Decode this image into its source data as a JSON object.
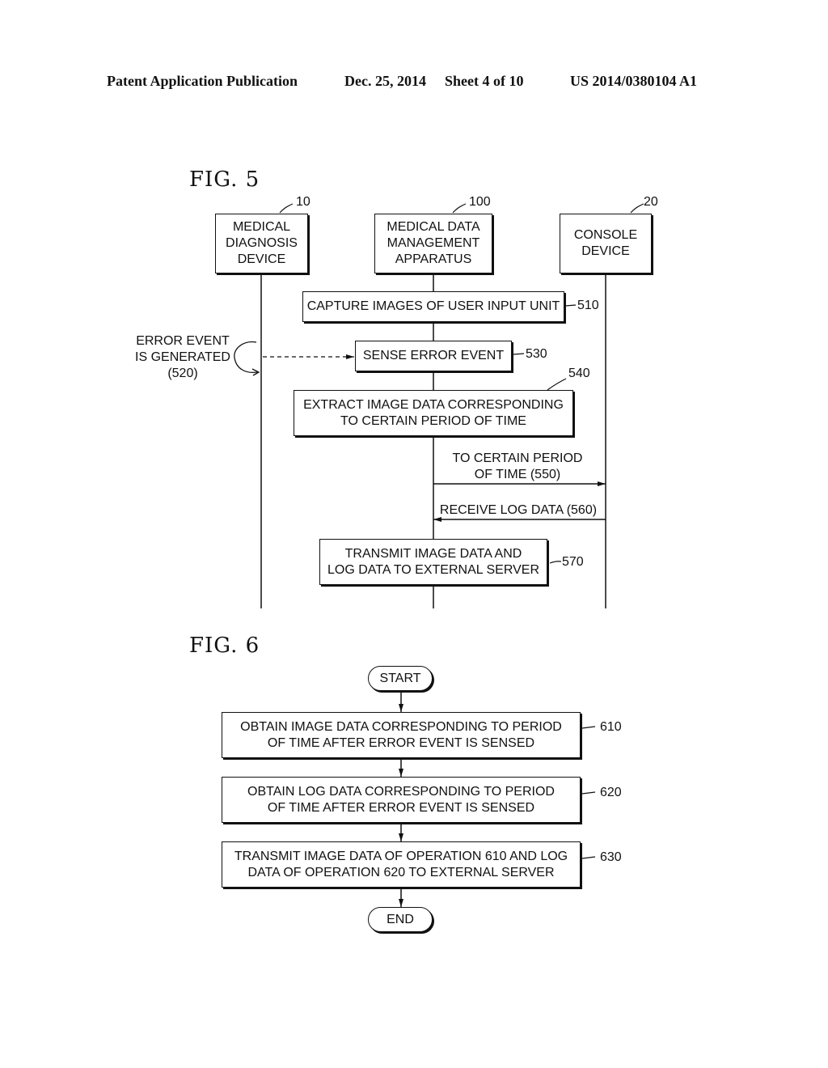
{
  "header": {
    "publication": "Patent Application Publication",
    "date": "Dec. 25, 2014",
    "sheet": "Sheet 4 of 10",
    "number": "US 2014/0380104 A1"
  },
  "fig5": {
    "title": "FIG.  5",
    "entities": [
      {
        "ref": "10",
        "label": "MEDICAL\nDIAGNOSIS\nDEVICE"
      },
      {
        "ref": "100",
        "label": "MEDICAL DATA\nMANAGEMENT\nAPPARATUS"
      },
      {
        "ref": "20",
        "label": "CONSOLE\nDEVICE"
      }
    ],
    "steps": [
      {
        "ref": "510",
        "label": "CAPTURE IMAGES OF USER INPUT UNIT"
      },
      {
        "ref": "530",
        "label": "SENSE ERROR EVENT"
      },
      {
        "ref": "540",
        "label": "EXTRACT IMAGE DATA CORRESPONDING\nTO CERTAIN PERIOD OF TIME"
      },
      {
        "ref": "570",
        "label": "TRANSMIT IMAGE DATA AND\nLOG DATA TO EXTERNAL SERVER"
      }
    ],
    "event_label": "ERROR EVENT\nIS GENERATED\n(520)",
    "messages": [
      {
        "label": "TO CERTAIN PERIOD\nOF TIME (550)"
      },
      {
        "label": "RECEIVE LOG DATA (560)"
      }
    ]
  },
  "fig6": {
    "title": "FIG.  6",
    "start": "START",
    "end": "END",
    "steps": [
      {
        "ref": "610",
        "label": "OBTAIN IMAGE DATA CORRESPONDING TO PERIOD\nOF TIME AFTER ERROR EVENT IS SENSED"
      },
      {
        "ref": "620",
        "label": "OBTAIN LOG DATA CORRESPONDING TO PERIOD\nOF TIME AFTER ERROR EVENT IS SENSED"
      },
      {
        "ref": "630",
        "label": "TRANSMIT IMAGE DATA OF OPERATION 610 AND LOG\nDATA OF OPERATION 620 TO EXTERNAL SERVER"
      }
    ]
  }
}
